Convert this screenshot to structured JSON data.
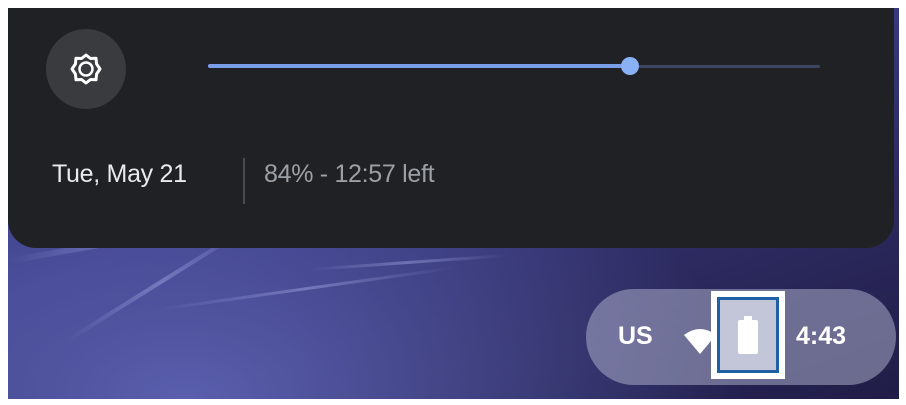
{
  "quick_settings": {
    "brightness_icon": "brightness-icon",
    "brightness_level": 0.69,
    "date": "Tue, May 21",
    "battery_status": "84% - 12:57 left"
  },
  "shelf": {
    "language": "US",
    "wifi_icon": "wifi-icon",
    "battery_icon": "battery-icon",
    "time": "4:43"
  },
  "colors": {
    "panel_bg": "#202124",
    "slider_active": "#7a9de8",
    "slider_thumb": "#8ab0f5",
    "highlight_border": "#1f5fa3"
  }
}
